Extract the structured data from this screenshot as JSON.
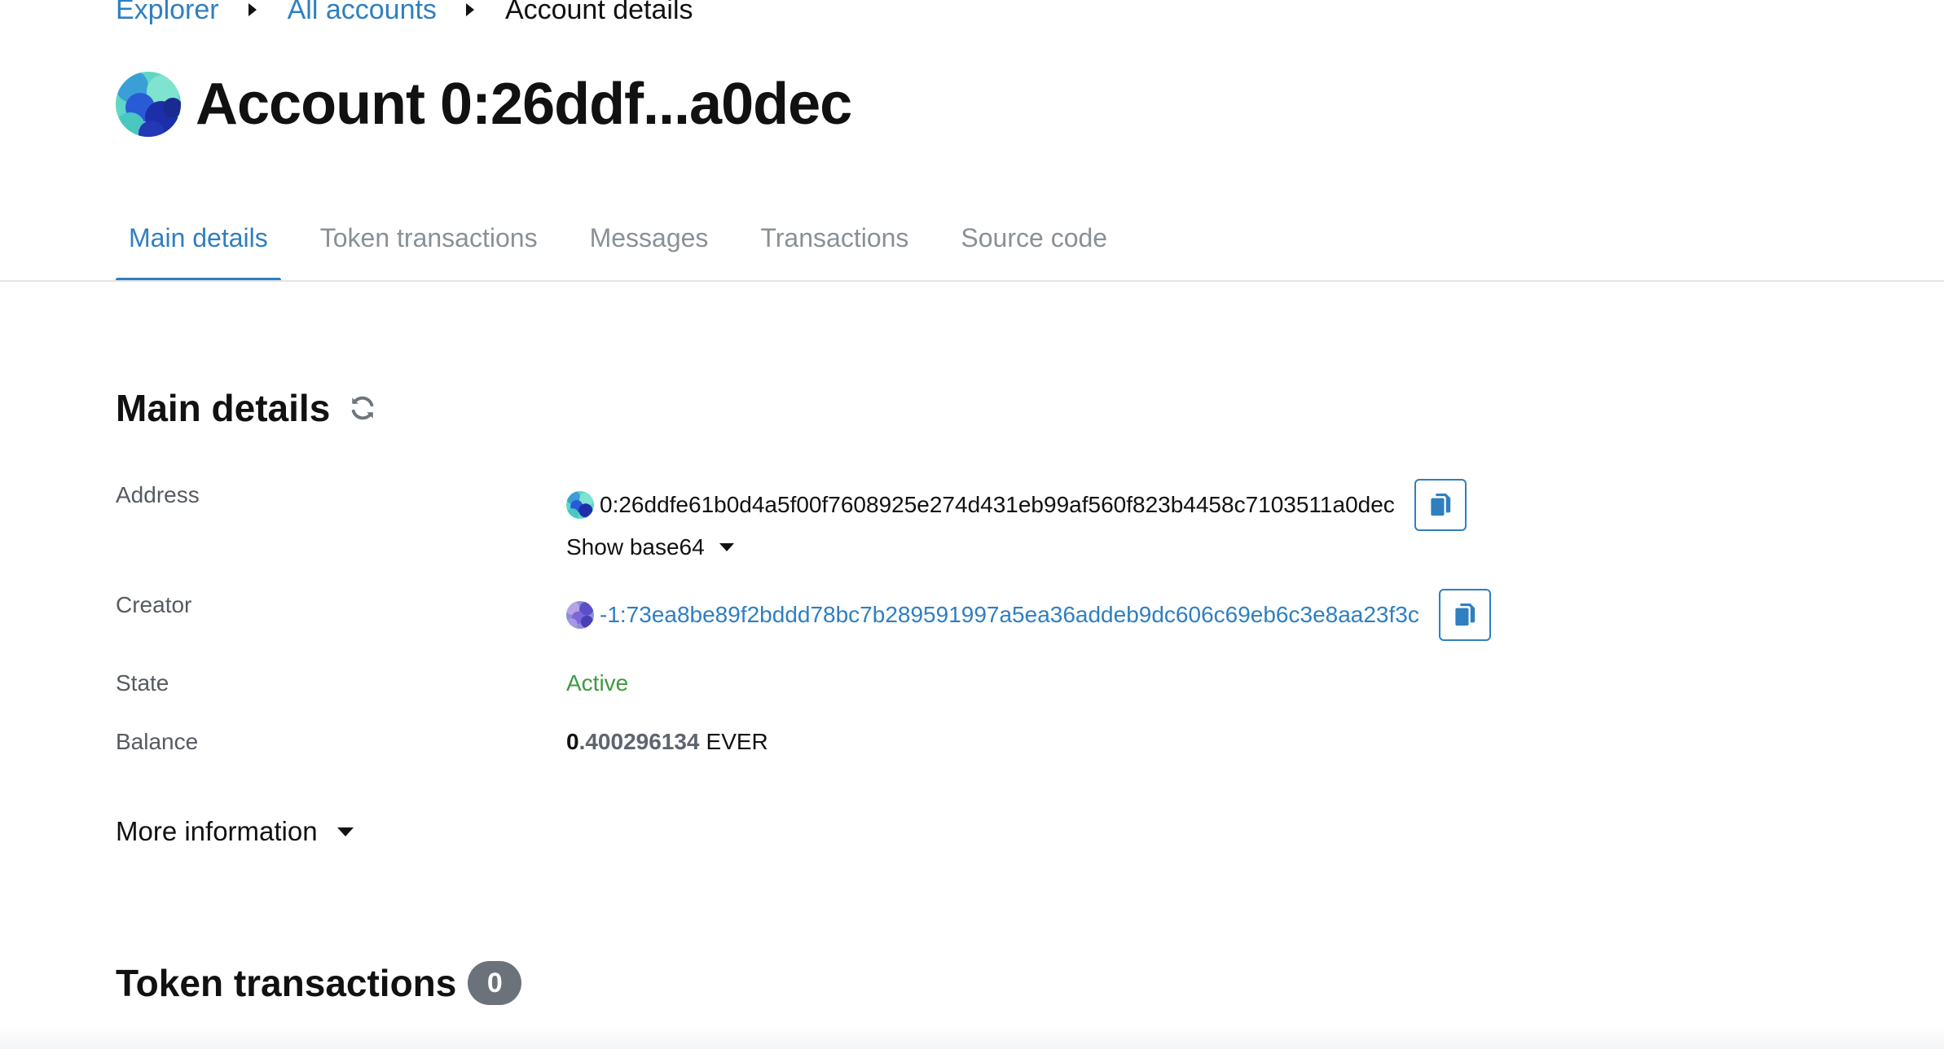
{
  "breadcrumb": {
    "items": [
      "Explorer",
      "All accounts"
    ],
    "current": "Account details"
  },
  "page_title": "Account 0:26ddf...a0dec",
  "tabs": [
    {
      "label": "Main details",
      "active": true
    },
    {
      "label": "Token transactions",
      "active": false
    },
    {
      "label": "Messages",
      "active": false
    },
    {
      "label": "Transactions",
      "active": false
    },
    {
      "label": "Source code",
      "active": false
    }
  ],
  "main_details": {
    "title": "Main details",
    "address": {
      "label": "Address",
      "value": "0:26ddfe61b0d4a5f00f7608925e274d431eb99af560f823b4458c7103511a0dec",
      "show_base64": "Show base64"
    },
    "creator": {
      "label": "Creator",
      "value": "-1:73ea8be89f2bddd78bc7b289591997a5ea36addeb9dc606c69eb6c3e8aa23f3c"
    },
    "state": {
      "label": "State",
      "value": "Active"
    },
    "balance": {
      "label": "Balance",
      "integer": "0",
      "fraction": ".400296134",
      "unit": "EVER"
    },
    "more_information": "More information"
  },
  "token_transactions": {
    "title": "Token transactions",
    "count": "0"
  },
  "colors": {
    "accent": "#2f7fc1",
    "active_state": "#3d9a3f",
    "badge": "#6c7279"
  },
  "icons": [
    "account-avatar-icon",
    "refresh-icon",
    "copy-icon",
    "caret-down-icon",
    "chevron-right-icon"
  ]
}
